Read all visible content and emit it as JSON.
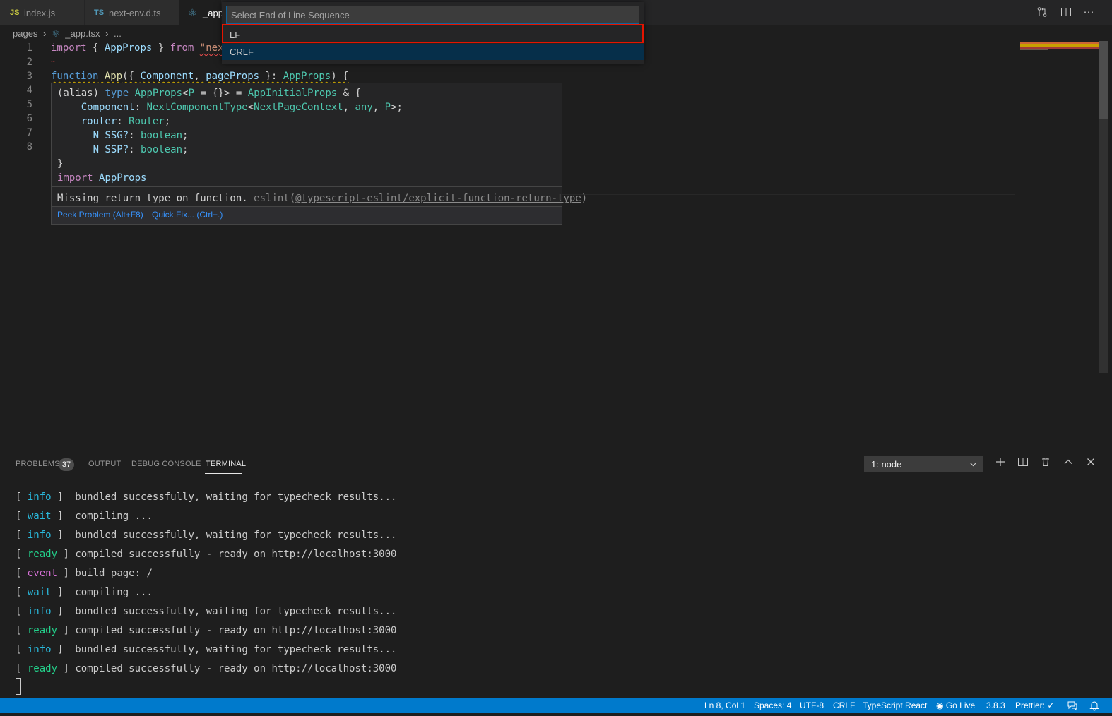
{
  "tabs": [
    {
      "icon": "JS",
      "icon_color": "#cbcb41",
      "label": "index.js"
    },
    {
      "icon": "TS",
      "icon_color": "#519aba",
      "label": "next-env.d.ts"
    },
    {
      "icon": "react-icon",
      "icon_color": "#519aba",
      "label": "_app"
    }
  ],
  "breadcrumb": {
    "folder": "pages",
    "file": "_app.tsx",
    "more": "..."
  },
  "editor": {
    "line_numbers": [
      "1",
      "2",
      "3",
      "4",
      "5",
      "6",
      "7",
      "8"
    ],
    "line1": {
      "kw": "import",
      "p1": " { ",
      "name": "AppProps",
      "p2": " } ",
      "from": "from",
      "sp": " ",
      "str": "\"next"
    },
    "line3": {
      "kw": "function",
      "sp": " ",
      "fn": "App",
      "p1": "({ ",
      "a": "Component",
      "c": ", ",
      "b": "pageProps",
      "p2": " }: ",
      "ty": "AppProps",
      "p3": ") {"
    }
  },
  "hover": {
    "l1": {
      "a": "(alias) ",
      "b": "type ",
      "c": "AppProps",
      "d": "<",
      "e": "P",
      "f": " = {}> = ",
      "g": "AppInitialProps",
      "h": " & {"
    },
    "l2": {
      "a": "    ",
      "b": "Component",
      "c": ": ",
      "d": "NextComponentType",
      "e": "<",
      "f": "NextPageContext",
      "g": ", ",
      "h": "any",
      "i": ", ",
      "j": "P",
      "k": ">;"
    },
    "l3": {
      "a": "    ",
      "b": "router",
      "c": ": ",
      "d": "Router",
      "e": ";"
    },
    "l4": {
      "a": "    ",
      "b": "__N_SSG?",
      "c": ": ",
      "d": "boolean",
      "e": ";"
    },
    "l5": {
      "a": "    ",
      "b": "__N_SSP?",
      "c": ": ",
      "d": "boolean",
      "e": ";"
    },
    "l6": "}",
    "l7": {
      "a": "import ",
      "b": "AppProps"
    },
    "problem": {
      "msg": "Missing return type on function. ",
      "src": "eslint(",
      "rule": "@typescript-eslint/explicit-function-return-type",
      "end": ")"
    },
    "peek": "Peek Problem (Alt+F8)",
    "quickfix": "Quick Fix... (Ctrl+.)"
  },
  "quickpick": {
    "placeholder": "Select End of Line Sequence",
    "items": [
      "LF",
      "CRLF"
    ],
    "highlight_color": "#e51400"
  },
  "panel": {
    "tabs": [
      "PROBLEMS",
      "OUTPUT",
      "DEBUG CONSOLE",
      "TERMINAL"
    ],
    "problems_count": "37",
    "terminal_select": "1: node",
    "terminal_lines": [
      {
        "tag": "info",
        "pre": " ",
        "text": "  bundled successfully, waiting for typecheck results..."
      },
      {
        "tag": "wait",
        "pre": " ",
        "text": "  compiling ..."
      },
      {
        "tag": "info",
        "pre": " ",
        "text": "  bundled successfully, waiting for typecheck results..."
      },
      {
        "tag": "ready",
        "pre": " ",
        "text": " compiled successfully - ready on http://localhost:3000"
      },
      {
        "tag": "event",
        "pre": " ",
        "text": " build page: /"
      },
      {
        "tag": "wait",
        "pre": " ",
        "text": "  compiling ..."
      },
      {
        "tag": "info",
        "pre": " ",
        "text": "  bundled successfully, waiting for typecheck results..."
      },
      {
        "tag": "ready",
        "pre": " ",
        "text": " compiled successfully - ready on http://localhost:3000"
      },
      {
        "tag": "info",
        "pre": " ",
        "text": "  bundled successfully, waiting for typecheck results..."
      },
      {
        "tag": "ready",
        "pre": " ",
        "text": " compiled successfully - ready on http://localhost:3000"
      }
    ]
  },
  "statusbar": {
    "position": "Ln 8, Col 1",
    "spaces": "Spaces: 4",
    "encoding": "UTF-8",
    "eol": "CRLF",
    "language": "TypeScript React",
    "golive": "Go Live",
    "version": "3.8.3",
    "prettier": "Prettier: ✓"
  },
  "colors": {
    "statusbar": "#007acc",
    "accent": "#0e639c"
  }
}
